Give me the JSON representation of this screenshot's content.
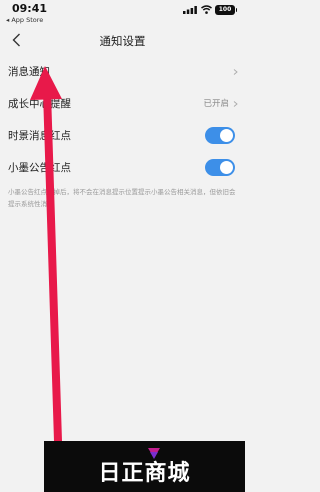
{
  "status_bar": {
    "time": "09:41",
    "back_app": "◂ App Store",
    "battery": "100"
  },
  "nav": {
    "title": "通知设置",
    "back_icon": "chevron-left-icon"
  },
  "rows": [
    {
      "label": "消息通知",
      "value": "",
      "control": "chevron"
    },
    {
      "label": "成长中心提醒",
      "value": "已开启",
      "control": "chevron"
    },
    {
      "label": "时景消息红点",
      "value": "",
      "control": "toggle",
      "on": true
    },
    {
      "label": "小墨公告红点",
      "value": "",
      "control": "toggle",
      "on": true
    }
  ],
  "footnote": "小墨公告红点关掉后，将不会在消息提示位置提示小墨公告相关消息，但依旧会提示系统性消息",
  "watermark": {
    "text": "日正商城"
  },
  "colors": {
    "accent": "#3d8fe8",
    "annotation_arrow": "#e8194a",
    "background": "#f2f2f2"
  }
}
